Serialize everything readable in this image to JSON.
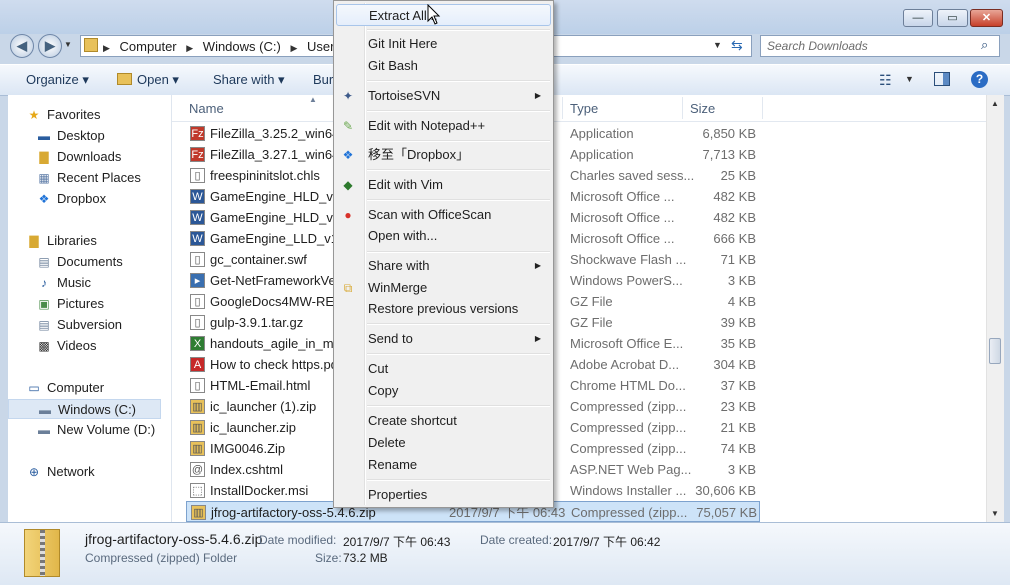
{
  "window": {
    "minimize_icon": "minimize-icon",
    "maximize_icon": "maximize-icon",
    "close_icon": "close-icon",
    "minimize_glyph": "—",
    "maximize_glyph": "▭",
    "close_glyph": "✕"
  },
  "address": {
    "crumbs": [
      "Computer",
      "Windows (C:)",
      "Users"
    ],
    "search_placeholder": "Search Downloads"
  },
  "toolbar": {
    "organize": "Organize ▾",
    "open": "Open ▾",
    "share_with": "Share with ▾",
    "burn_partial": "Bur"
  },
  "nav": {
    "favorites": "Favorites",
    "desktop": "Desktop",
    "downloads": "Downloads",
    "recent_places": "Recent Places",
    "dropbox": "Dropbox",
    "libraries": "Libraries",
    "documents": "Documents",
    "music": "Music",
    "pictures": "Pictures",
    "subversion": "Subversion",
    "videos": "Videos",
    "computer": "Computer",
    "windows_c": "Windows (C:)",
    "new_volume_d": "New Volume (D:)",
    "network": "Network"
  },
  "columns": {
    "name": "Name",
    "type": "Type",
    "size": "Size"
  },
  "files": [
    {
      "name": "FileZilla_3.25.2_win64-s",
      "date": "",
      "type": "Application",
      "size": "6,850 KB",
      "icon": "filezilla-icon"
    },
    {
      "name": "FileZilla_3.27.1_win64-s",
      "date": "",
      "type": "Application",
      "size": "7,713 KB",
      "icon": "filezilla-icon"
    },
    {
      "name": "freespininitslot.chls",
      "date": "",
      "type": "Charles saved sess...",
      "size": "25 KB",
      "icon": "document-icon"
    },
    {
      "name": "GameEngine_HLD_v1.2",
      "date": "",
      "type": "Microsoft Office ...",
      "size": "482 KB",
      "icon": "word-icon"
    },
    {
      "name": "GameEngine_HLD_v1.2",
      "date": "",
      "type": "Microsoft Office ...",
      "size": "482 KB",
      "icon": "word-icon"
    },
    {
      "name": "GameEngine_LLD_v1.1.",
      "date": "",
      "type": "Microsoft Office ...",
      "size": "666 KB",
      "icon": "word-icon"
    },
    {
      "name": "gc_container.swf",
      "date": "",
      "type": "Shockwave Flash ...",
      "size": "71 KB",
      "icon": "document-icon"
    },
    {
      "name": "Get-NetFrameworkVers",
      "date": "",
      "type": "Windows PowerS...",
      "size": "3 KB",
      "icon": "script-icon"
    },
    {
      "name": "GoogleDocs4MW-REL1",
      "date": "",
      "type": "GZ File",
      "size": "4 KB",
      "icon": "document-icon"
    },
    {
      "name": "gulp-3.9.1.tar.gz",
      "date": "",
      "type": "GZ File",
      "size": "39 KB",
      "icon": "document-icon"
    },
    {
      "name": "handouts_agile_in_mar",
      "date": "",
      "type": "Microsoft Office E...",
      "size": "35 KB",
      "icon": "excel-icon"
    },
    {
      "name": "How to check https.pdf",
      "date": "",
      "type": "Adobe Acrobat D...",
      "size": "304 KB",
      "icon": "pdf-icon"
    },
    {
      "name": "HTML-Email.html",
      "date": "",
      "type": "Chrome HTML Do...",
      "size": "37 KB",
      "icon": "document-icon"
    },
    {
      "name": "ic_launcher (1).zip",
      "date": "",
      "type": "Compressed (zipp...",
      "size": "23 KB",
      "icon": "zip-folder-icon"
    },
    {
      "name": "ic_launcher.zip",
      "date": "",
      "type": "Compressed (zipp...",
      "size": "21 KB",
      "icon": "zip-folder-icon"
    },
    {
      "name": "IMG0046.Zip",
      "date": "",
      "type": "Compressed (zipp...",
      "size": "74 KB",
      "icon": "zip-folder-icon"
    },
    {
      "name": "Index.cshtml",
      "date": "",
      "type": "ASP.NET Web Pag...",
      "size": "3 KB",
      "icon": "web-file-icon"
    },
    {
      "name": "InstallDocker.msi",
      "date": "",
      "type": "Windows Installer ...",
      "size": "30,606 KB",
      "icon": "installer-icon"
    },
    {
      "name": "jfrog-artifactory-oss-5.4.6.zip",
      "date": "2017/9/7 下午 06:43",
      "type": "Compressed (zipp...",
      "size": "75,057 KB",
      "icon": "zip-folder-icon"
    }
  ],
  "context_menu": {
    "extract_all": "Extract All...",
    "git_init_here": "Git Init Here",
    "git_bash": "Git Bash",
    "tortoisesvn": "TortoiseSVN",
    "edit_notepadpp": "Edit with Notepad++",
    "move_to_dropbox": "移至「Dropbox」",
    "edit_with_vim": "Edit with Vim",
    "scan_officescan": "Scan with OfficeScan",
    "open_with": "Open with...",
    "share_with": "Share with",
    "winmerge": "WinMerge",
    "restore_previous": "Restore previous versions",
    "send_to": "Send to",
    "cut": "Cut",
    "copy": "Copy",
    "create_shortcut": "Create shortcut",
    "delete": "Delete",
    "rename": "Rename",
    "properties": "Properties"
  },
  "details": {
    "filename": "jfrog-artifactory-oss-5.4.6.zip",
    "filetype": "Compressed (zipped) Folder",
    "date_modified_label": "Date modified:",
    "date_modified": "2017/9/7 下午 06:43",
    "date_created_label": "Date created:",
    "date_created": "2017/9/7 下午 06:42",
    "size_label": "Size:",
    "size": "73.2 MB"
  },
  "colors": {
    "selection": "#cde3f8",
    "accent": "#1e395b",
    "folder": "#e8c15a"
  }
}
